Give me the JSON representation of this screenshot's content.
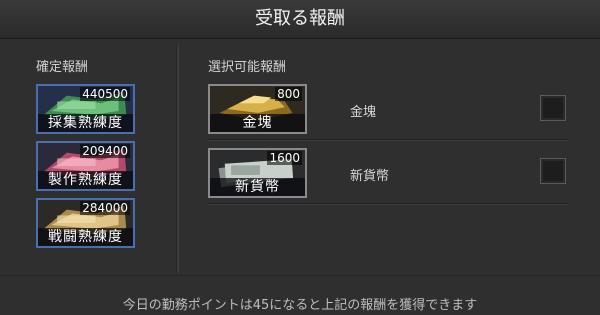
{
  "window": {
    "title": "受取る報酬"
  },
  "fixed_rewards": {
    "heading": "確定報酬",
    "items": [
      {
        "amount": "440500",
        "label": "採集熟練度",
        "icon": "gathering-skill-icon"
      },
      {
        "amount": "209400",
        "label": "製作熟練度",
        "icon": "crafting-skill-icon"
      },
      {
        "amount": "284000",
        "label": "戦闘熟練度",
        "icon": "combat-skill-icon"
      }
    ]
  },
  "selectable_rewards": {
    "heading": "選択可能報酬",
    "items": [
      {
        "amount": "800",
        "label": "金塊",
        "name": "金塊",
        "checked": false,
        "icon": "gold-bar-icon"
      },
      {
        "amount": "1600",
        "label": "新貨幣",
        "name": "新貨幣",
        "checked": false,
        "icon": "new-currency-icon"
      }
    ]
  },
  "footer": {
    "message": "今日の勤務ポイントは45になると上記の報酬を獲得できます"
  }
}
